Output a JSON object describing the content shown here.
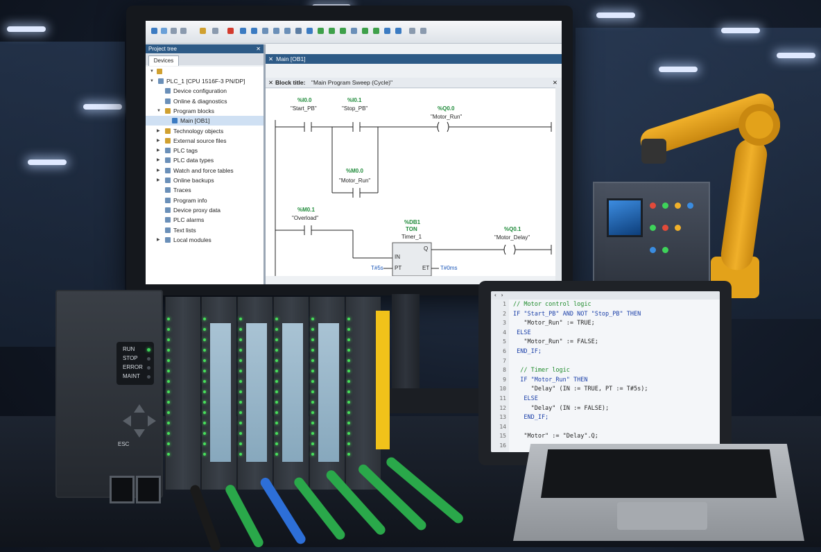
{
  "toolbar": {
    "icons": [
      "save-icon",
      "new-icon",
      "open-icon",
      "cut-icon",
      "copy-icon",
      "paste-icon",
      "delete-icon",
      "undo-icon",
      "redo-icon",
      "compile-icon",
      "download-icon",
      "upload-icon",
      "go-online-icon",
      "go-offline-icon",
      "monitor-icon"
    ]
  },
  "project_tree": {
    "header": "Project tree",
    "close_glyph": "✕",
    "tab": "Devices",
    "items": [
      {
        "label": "PLC_1 [CPU 1516F-3 PN/DP]",
        "indent": 0,
        "arrow": "▼",
        "icon": "cpu-icon"
      },
      {
        "label": "Device configuration",
        "indent": 1,
        "arrow": "",
        "icon": "device-config-icon"
      },
      {
        "label": "Online & diagnostics",
        "indent": 1,
        "arrow": "",
        "icon": "diagnostics-icon"
      },
      {
        "label": "Program blocks",
        "indent": 1,
        "arrow": "▼",
        "icon": "folder-icon"
      },
      {
        "label": "Main [OB1]",
        "indent": 2,
        "arrow": "",
        "icon": "block-icon",
        "selected": true
      },
      {
        "label": "Technology objects",
        "indent": 1,
        "arrow": "▶",
        "icon": "folder-icon"
      },
      {
        "label": "External source files",
        "indent": 1,
        "arrow": "▶",
        "icon": "folder-icon"
      },
      {
        "label": "PLC tags",
        "indent": 1,
        "arrow": "▶",
        "icon": "tags-icon"
      },
      {
        "label": "PLC data types",
        "indent": 1,
        "arrow": "▶",
        "icon": "datatype-icon"
      },
      {
        "label": "Watch and force tables",
        "indent": 1,
        "arrow": "▶",
        "icon": "watch-icon"
      },
      {
        "label": "Online backups",
        "indent": 1,
        "arrow": "▶",
        "icon": "backup-icon"
      },
      {
        "label": "Traces",
        "indent": 1,
        "arrow": "",
        "icon": "traces-icon"
      },
      {
        "label": "Program info",
        "indent": 1,
        "arrow": "",
        "icon": "info-icon"
      },
      {
        "label": "Device proxy data",
        "indent": 1,
        "arrow": "",
        "icon": "proxy-icon"
      },
      {
        "label": "PLC alarms",
        "indent": 1,
        "arrow": "",
        "icon": "alarm-icon"
      },
      {
        "label": "Text lists",
        "indent": 1,
        "arrow": "",
        "icon": "textlist-icon"
      },
      {
        "label": "Local modules",
        "indent": 1,
        "arrow": "▶",
        "icon": "modules-icon"
      }
    ]
  },
  "editor": {
    "tab_title": "Main [OB1]",
    "close_glyph": "✕",
    "block_title_label": "Block title:",
    "block_title_value": "\"Main Program Sweep (Cycle)\"",
    "network1": {
      "contact1_addr": "%I0.0",
      "contact1_sym": "\"Start_PB\"",
      "contact2_addr": "%I0.1",
      "contact2_sym": "\"Stop_PB\"",
      "coil_addr": "%Q0.0",
      "coil_sym": "\"Motor_Run\"",
      "seal_addr": "%M0.0",
      "seal_sym": "\"Motor_Run\""
    },
    "network2": {
      "contact_addr": "%M0.1",
      "contact_sym": "\"Overload\"",
      "timer_db": "%DB1",
      "timer_type": "TON",
      "timer_name": "Timer_1",
      "pin_in": "IN",
      "pin_pt": "PT",
      "pin_et": "ET",
      "pin_q": "Q",
      "pt_value": "T#5s",
      "et_value": "T#0ms",
      "coil_addr": "%Q0.1",
      "coil_sym": "\"Motor_Delay\""
    }
  },
  "plc": {
    "status_labels": [
      "RUN",
      "STOP",
      "ERROR",
      "MAINT"
    ],
    "run_led_color": "#3ed35a",
    "esc_label": "ESC"
  },
  "code_editor": {
    "nav": "‹ ›",
    "lines": [
      {
        "num": "1",
        "text": "// Motor control logic",
        "kind": "cmt"
      },
      {
        "num": "2",
        "text": "IF \"Start_PB\" AND NOT \"Stop_PB\" THEN",
        "kind": "kw"
      },
      {
        "num": "3",
        "text": "   \"Motor_Run\" := TRUE;",
        "kind": ""
      },
      {
        "num": "4",
        "text": " ELSE",
        "kind": "kw"
      },
      {
        "num": "5",
        "text": "   \"Motor_Run\" := FALSE;",
        "kind": ""
      },
      {
        "num": "6",
        "text": " END_IF;",
        "kind": "kw"
      },
      {
        "num": "7",
        "text": "",
        "kind": ""
      },
      {
        "num": "8",
        "text": "  // Timer logic",
        "kind": "cmt"
      },
      {
        "num": "9",
        "text": "  IF \"Motor_Run\" THEN",
        "kind": "kw"
      },
      {
        "num": "10",
        "text": "     \"Delay\" (IN := TRUE, PT := T#5s);",
        "kind": ""
      },
      {
        "num": "11",
        "text": "   ELSE",
        "kind": "kw"
      },
      {
        "num": "12",
        "text": "     \"Delay\" (IN := FALSE);",
        "kind": ""
      },
      {
        "num": "13",
        "text": "   END_IF;",
        "kind": "kw"
      },
      {
        "num": "14",
        "text": "",
        "kind": ""
      },
      {
        "num": "15",
        "text": "   \"Motor\" := \"Delay\".Q;",
        "kind": ""
      },
      {
        "num": "16",
        "text": "",
        "kind": ""
      }
    ]
  },
  "colors": {
    "address_green": "#1f8a3a",
    "constant_blue": "#1a56b8",
    "tree_header": "#2d5a86",
    "module_yellow": "#f1c21a"
  }
}
